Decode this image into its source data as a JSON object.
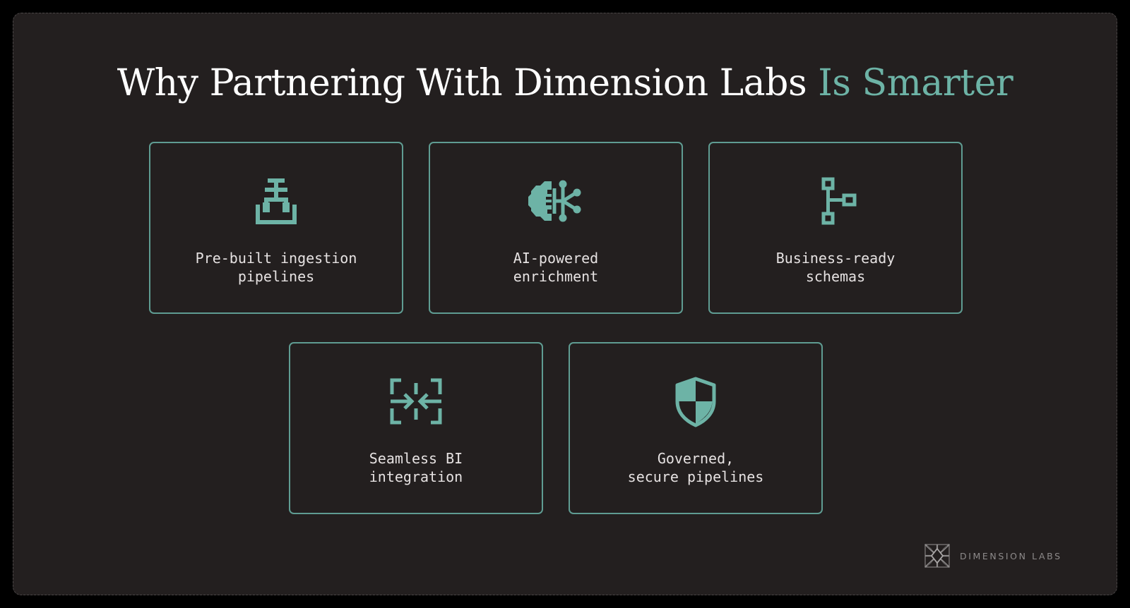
{
  "title": {
    "main": "Why Partnering With Dimension Labs ",
    "accent": "Is Smarter"
  },
  "cards": [
    {
      "icon": "pipeline-valve-icon",
      "line1": "Pre-built ingestion",
      "line2": "pipelines"
    },
    {
      "icon": "ai-brain-icon",
      "line1": "AI-powered",
      "line2": "enrichment"
    },
    {
      "icon": "schema-hierarchy-icon",
      "line1": "Business-ready",
      "line2": "schemas"
    },
    {
      "icon": "merge-arrows-icon",
      "line1": "Seamless BI",
      "line2": "integration"
    },
    {
      "icon": "shield-icon",
      "line1": "Governed,",
      "line2": "secure pipelines"
    }
  ],
  "brand": {
    "logo": "dimension-labs-logo",
    "name": "DIMENSION LABS"
  },
  "colors": {
    "background": "#231f1f",
    "accent": "#6db3a6",
    "card_border": "#5f9c92",
    "text": "#e6e2e2"
  }
}
